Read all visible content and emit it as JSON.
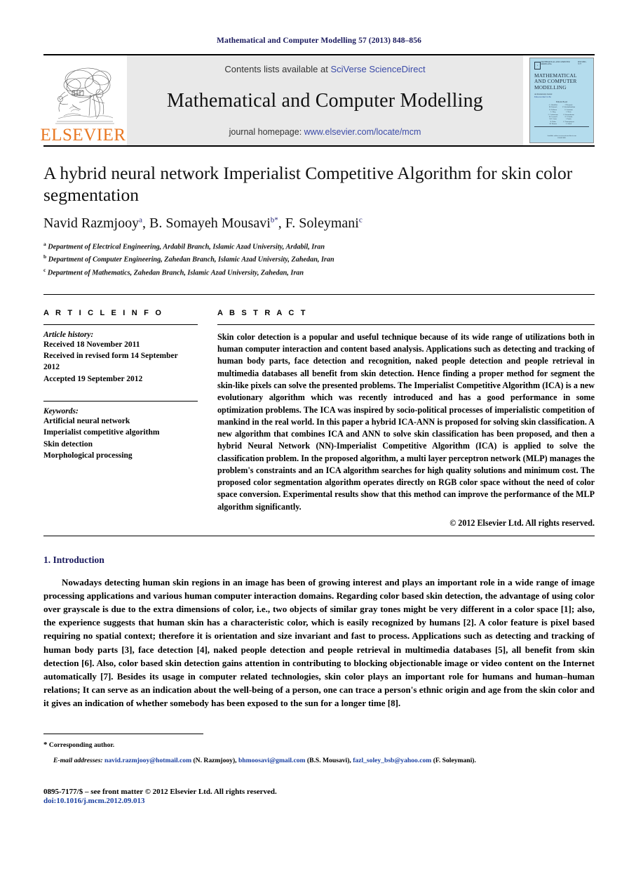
{
  "running_head": "Mathematical and Computer Modelling 57 (2013) 848–856",
  "banner": {
    "publisher_logo_text": "ELSEVIER",
    "contents_prefix": "Contents lists available at ",
    "contents_link": "SciVerse ScienceDirect",
    "journal_name": "Mathematical and Computer Modelling",
    "homepage_prefix": "journal homepage: ",
    "homepage_link": "www.elsevier.com/locate/mcm",
    "cover": {
      "masthead_left": "MATHEMATICAL AND COMPUTER MODELLING",
      "masthead_right": "ISSN 0895-7177",
      "title_lines": [
        "MATHEMATICAL",
        "AND COMPUTER",
        "MODELLING"
      ],
      "subtitle_line1": "An International Journal",
      "subtitle_line2": "Editor-in-Chief: X. Hu",
      "board_title": "Editorial Board",
      "board_col1": [
        "A. Ahmadian",
        "M. Bartusek",
        "R. Bellman",
        "L. Berg",
        "C. Corduneanu",
        "D. Cresswell",
        "W. F. Ames",
        "R. Datko",
        "M. Drmota"
      ],
      "board_col2": [
        "J. Kacprzyk",
        "V. Lakshmikantham",
        "G. Leitmann",
        "J. Nieto",
        "S. Sivasundaram",
        "E. Y. Rodin",
        "J. Taylor",
        "G. Tsamasphyros",
        "L. Zadeh"
      ],
      "footer_line1": "Available online at www.sciencedirect.com",
      "footer_line2": "ELSEVIER"
    }
  },
  "article": {
    "title": "A hybrid neural network Imperialist Competitive Algorithm for skin color segmentation",
    "authors": [
      {
        "name": "Navid Razmjooy",
        "sup": "a",
        "star": false
      },
      {
        "name": "B. Somayeh Mousavi",
        "sup": "b",
        "star": true
      },
      {
        "name": "F. Soleymani",
        "sup": "c",
        "star": false
      }
    ],
    "affiliations": [
      {
        "sup": "a",
        "text": "Department of Electrical Engineering, Ardabil Branch, Islamic Azad University, Ardabil, Iran"
      },
      {
        "sup": "b",
        "text": "Department of Computer Engineering, Zahedan Branch, Islamic Azad University, Zahedan, Iran"
      },
      {
        "sup": "c",
        "text": "Department of Mathematics, Zahedan Branch, Islamic Azad University, Zahedan, Iran"
      }
    ]
  },
  "article_info": {
    "heading": "A R T I C L E   I N F O",
    "history_label": "Article history:",
    "history_lines": [
      "Received 18 November 2011",
      "Received in revised form 14 September",
      "2012",
      "Accepted 19 September 2012"
    ],
    "keywords_label": "Keywords:",
    "keywords": [
      "Artificial neural network",
      "Imperialist competitive algorithm",
      "Skin detection",
      "Morphological processing"
    ]
  },
  "abstract": {
    "heading": "A B S T R A C T",
    "text": "Skin color detection is a popular and useful technique because of its wide range of utilizations both in human computer interaction and content based analysis. Applications such as detecting and tracking of human body parts, face detection and recognition, naked people detection and people retrieval in multimedia databases all benefit from skin detection. Hence finding a proper method for segment the skin-like pixels can solve the presented problems. The Imperialist Competitive Algorithm (ICA) is a new evolutionary algorithm which was recently introduced and has a good performance in some optimization problems. The ICA was inspired by socio-political processes of imperialistic competition of mankind in the real world. In this paper a hybrid ICA-ANN is proposed for solving skin classification. A new algorithm that combines ICA and ANN to solve skin classification has been proposed, and then a hybrid Neural Network (NN)-Imperialist Competitive Algorithm (ICA) is applied to solve the classification problem. In the proposed algorithm, a multi layer perceptron network (MLP) manages the problem's constraints and an ICA algorithm searches for high quality solutions and minimum cost. The proposed color segmentation algorithm operates directly on RGB color space without the need of color space conversion. Experimental results show that this method can improve the performance of the MLP algorithm significantly.",
    "copyright": "© 2012 Elsevier Ltd. All rights reserved."
  },
  "introduction": {
    "number": "1.",
    "title": "Introduction",
    "paragraph": "Nowadays detecting human skin regions in an image has been of growing interest and plays an important role in a wide range of image processing applications and various human computer interaction domains. Regarding color based skin detection, the advantage of using color over grayscale is due to the extra dimensions of color, i.e., two objects of similar gray tones might be very different in a color space [1]; also, the experience suggests that human skin has a characteristic color, which is easily recognized by humans [2]. A color feature is pixel based requiring no spatial context; therefore it is orientation and size invariant and fast to process. Applications such as detecting and tracking of human body parts [3], face detection [4], naked people detection and people retrieval in multimedia databases [5], all benefit from skin detection [6]. Also, color based skin detection gains attention in contributing to blocking objectionable image or video content on the Internet automatically [7]. Besides its usage in computer related technologies, skin color plays an important role for humans and human–human relations; It can serve as an indication about the well-being of a person, one can trace a person's ethnic origin and age from the skin color and it gives an indication of whether somebody has been exposed to the sun for a longer time [8]."
  },
  "footnotes": {
    "corresponding_star": "*",
    "corresponding_text": "Corresponding author.",
    "email_label": "E-mail addresses:",
    "emails": [
      {
        "address": "navid.razmjooy@hotmail.com",
        "owner": "(N. Razmjooy)"
      },
      {
        "address": "bhmoosavi@gmail.com",
        "owner": "(B.S. Mousavi)"
      },
      {
        "address": "fazl_soley_bsb@yahoo.com",
        "owner": "(F. Soleymani)"
      }
    ]
  },
  "imprint": {
    "issn_line": "0895-7177/$ – see front matter © 2012 Elsevier Ltd. All rights reserved.",
    "doi_line": "doi:10.1016/j.mcm.2012.09.013"
  }
}
